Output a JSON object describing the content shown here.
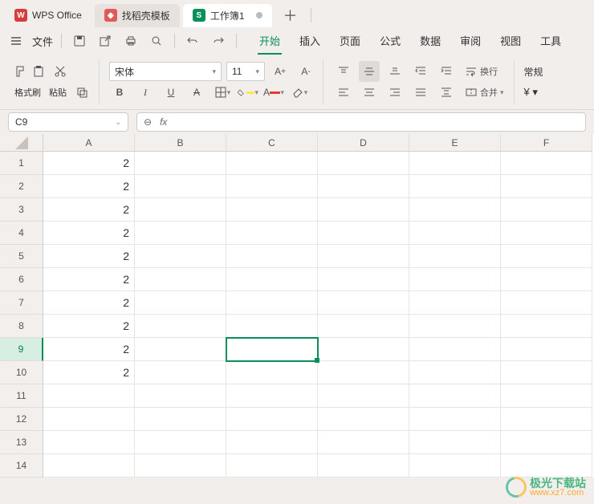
{
  "tabs": {
    "app": "WPS Office",
    "template": "找稻壳模板",
    "doc": "工作簿1"
  },
  "menubar": {
    "file": "文件",
    "tabs": [
      "开始",
      "插入",
      "页面",
      "公式",
      "数据",
      "审阅",
      "视图",
      "工具"
    ]
  },
  "ribbon": {
    "format_painter": "格式刷",
    "paste": "粘贴",
    "font_name": "宋体",
    "font_size": "11",
    "wrap": "换行",
    "merge": "合并",
    "normal": "常规"
  },
  "namebox": "C9",
  "fx": "fx",
  "columns": [
    "A",
    "B",
    "C",
    "D",
    "E",
    "F"
  ],
  "rows": [
    "1",
    "2",
    "3",
    "4",
    "5",
    "6",
    "7",
    "8",
    "9",
    "10",
    "11",
    "12",
    "13",
    "14"
  ],
  "cellsA": [
    "2",
    "2",
    "2",
    "2",
    "2",
    "2",
    "2",
    "2",
    "2",
    "2",
    "",
    "",
    "",
    ""
  ],
  "selected": {
    "row": 9,
    "col": "C"
  },
  "watermark": {
    "title": "极光下载站",
    "url": "www.xz7.com"
  }
}
